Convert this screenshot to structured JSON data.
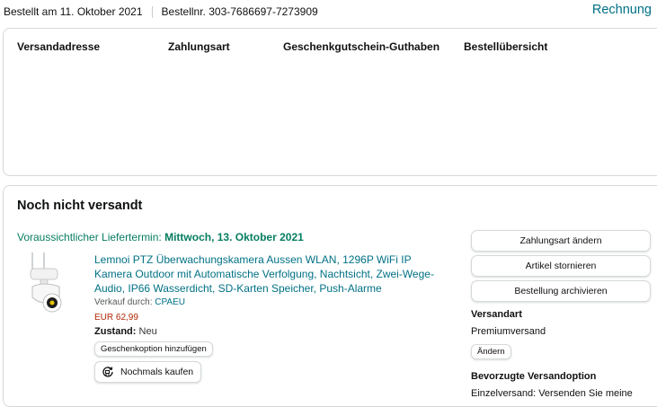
{
  "top": {
    "order_date": "Bestellt am 11. Oktober 2021",
    "order_number": "Bestellnr. 303-7686697-7273909",
    "invoice_link": "Rechnung"
  },
  "summary": {
    "headers": [
      "Versandadresse",
      "Zahlungsart",
      "Geschenkgutschein-Guthaben",
      "Bestellübersicht"
    ]
  },
  "shipment": {
    "title": "Noch nicht versandt",
    "delivery_label": "Voraussichtlicher Liefertermin:",
    "delivery_date": "Mittwoch, 13. Oktober 2021",
    "product_title": "Lemnoi PTZ Überwachungskamera Aussen WLAN, 1296P WiFi IP Kamera Outdoor mit Automatische Verfolgung, Nachtsicht, Zwei-Wege-Audio, IP66 Wasserdicht, SD-Karten Speicher, Push-Alarme",
    "seller_label": "Verkauf durch:",
    "seller_name": "CPAEU",
    "price": "EUR 62,99",
    "condition_label": "Zustand:",
    "condition_value": "Neu",
    "gift_option_button": "Geschenkoption hinzufügen",
    "buy_again_button": "Nochmals kaufen"
  },
  "actions": {
    "change_payment": "Zahlungsart ändern",
    "cancel_items": "Artikel stornieren",
    "archive_order": "Bestellung archivieren"
  },
  "shipping": {
    "method_title": "Versandart",
    "method_value": "Premiumversand",
    "change_button": "Ändern",
    "preferred_title": "Bevorzugte Versandoption",
    "preferred_text": "Einzelversand: Versenden Sie meine"
  },
  "colors": {
    "link": "#007185",
    "delivery_green": "#067d62",
    "price_red": "#b12704",
    "border": "#d5d9d9"
  },
  "icons": {
    "buy_again": "refresh-cart-icon",
    "product_image": "security-camera-icon"
  }
}
